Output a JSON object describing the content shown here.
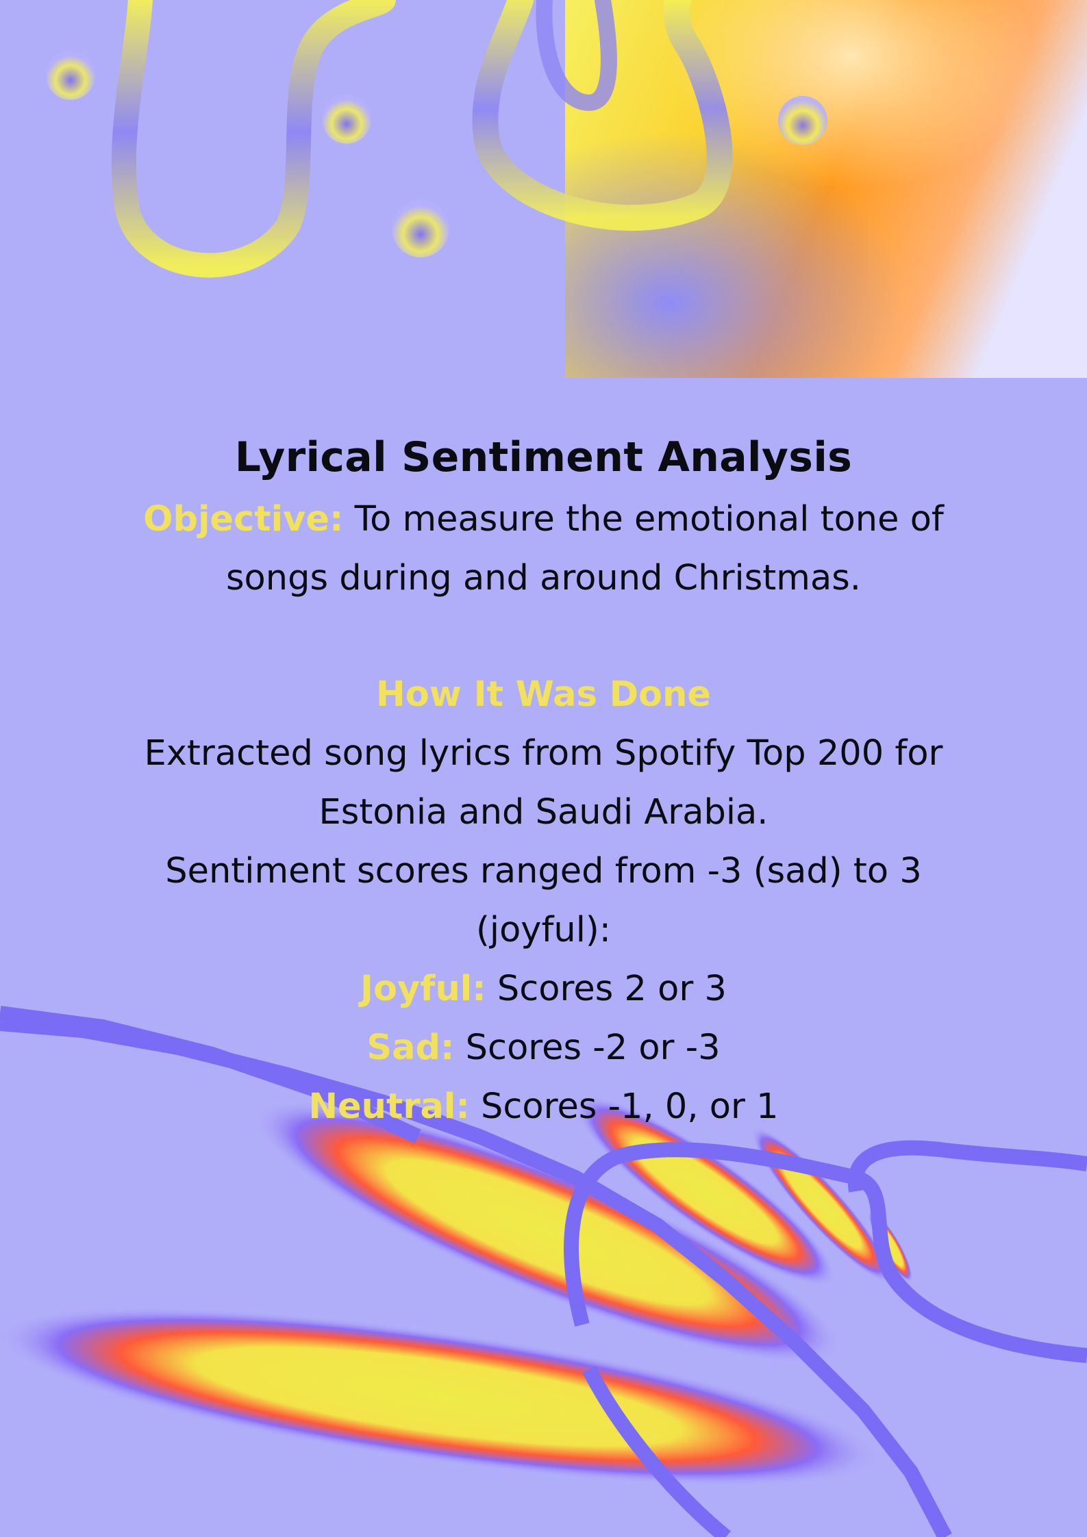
{
  "title": "Lyrical Sentiment Analysis",
  "objective": {
    "label": "Objective:",
    "text": "To measure the emotional tone of songs during and around Christmas."
  },
  "method": {
    "heading": "How It Was Done",
    "line1": "Extracted song lyrics from Spotify Top 200 for Estonia and Saudi Arabia.",
    "line2": "Sentiment scores ranged from -3 (sad) to 3 (joyful):"
  },
  "categories": [
    {
      "label": "Joyful:",
      "text": "Scores 2 or 3"
    },
    {
      "label": "Sad:",
      "text": "Scores -2 or -3"
    },
    {
      "label": "Neutral:",
      "text": "Scores -1, 0, or 1"
    }
  ],
  "colors": {
    "background": "#b0adf9",
    "accent": "#f2e15c",
    "text": "#0b0b12",
    "ribbon": "#7a6cf5"
  }
}
